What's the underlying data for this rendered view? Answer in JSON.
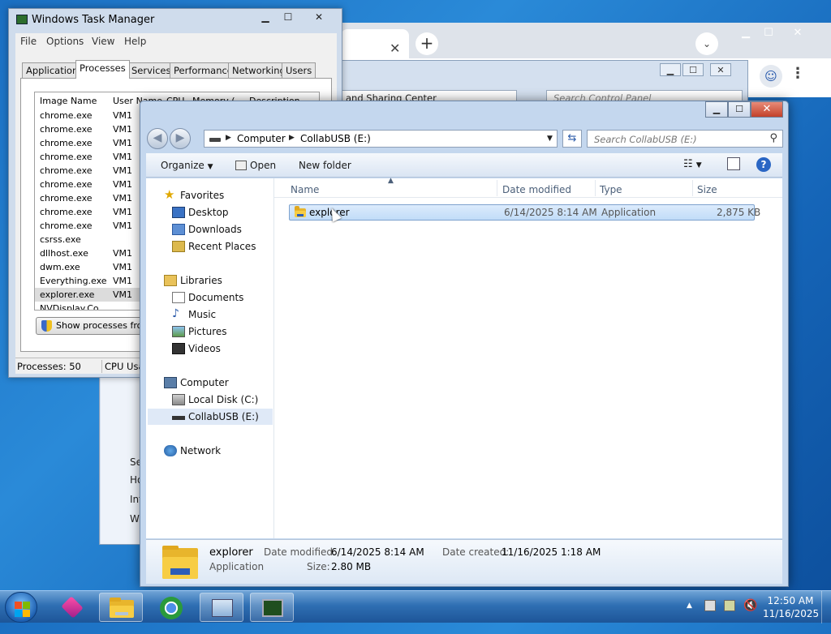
{
  "chrome": {
    "tab_close": "✕",
    "new_tab": "+",
    "menu_dropdown": "⌄",
    "profile_icon": "person-icon",
    "kebab": "⋮",
    "win_min": "▁",
    "win_max": "☐",
    "win_close": "✕"
  },
  "control_panel": {
    "address_text": "and Sharing Center",
    "search_placeholder": "Search Control Panel",
    "left_items": [
      "Se",
      "Ho",
      "Inf",
      "Wi"
    ]
  },
  "task_manager": {
    "title": "Windows Task Manager",
    "menu": [
      "File",
      "Options",
      "View",
      "Help"
    ],
    "tabs": [
      "Applications",
      "Processes",
      "Services",
      "Performance",
      "Networking",
      "Users"
    ],
    "active_tab": "Processes",
    "columns": [
      "Image Name",
      "User Name",
      "CPU",
      "Memory (...",
      "Description"
    ],
    "rows": [
      {
        "name": "chrome.exe",
        "user": "VM1"
      },
      {
        "name": "chrome.exe",
        "user": "VM1"
      },
      {
        "name": "chrome.exe",
        "user": "VM1"
      },
      {
        "name": "chrome.exe",
        "user": "VM1"
      },
      {
        "name": "chrome.exe",
        "user": "VM1"
      },
      {
        "name": "chrome.exe",
        "user": "VM1"
      },
      {
        "name": "chrome.exe",
        "user": "VM1"
      },
      {
        "name": "chrome.exe",
        "user": "VM1"
      },
      {
        "name": "chrome.exe",
        "user": "VM1"
      },
      {
        "name": "csrss.exe",
        "user": ""
      },
      {
        "name": "dllhost.exe",
        "user": "VM1"
      },
      {
        "name": "dwm.exe",
        "user": "VM1"
      },
      {
        "name": "Everything.exe",
        "user": "VM1"
      },
      {
        "name": "explorer.exe",
        "user": "VM1"
      },
      {
        "name": "NVDisplay.Co...",
        "user": ""
      }
    ],
    "selected_row": 13,
    "show_processes_button": "Show processes from",
    "status_processes": "Processes: 50",
    "status_cpu": "CPU Usa"
  },
  "explorer": {
    "breadcrumb": [
      "Computer",
      "CollabUSB (E:)"
    ],
    "search_placeholder": "Search CollabUSB (E:)",
    "toolbar": {
      "organize": "Organize",
      "open": "Open",
      "new_folder": "New folder"
    },
    "nav_tree": {
      "favorites": "Favorites",
      "desktop": "Desktop",
      "downloads": "Downloads",
      "recent_places": "Recent Places",
      "libraries": "Libraries",
      "documents": "Documents",
      "music": "Music",
      "pictures": "Pictures",
      "videos": "Videos",
      "computer": "Computer",
      "local_disk": "Local Disk (C:)",
      "collabusb": "CollabUSB (E:)",
      "network": "Network"
    },
    "columns": {
      "name": "Name",
      "date_modified": "Date modified",
      "type": "Type",
      "size": "Size"
    },
    "file": {
      "name": "explorer",
      "date_modified": "6/14/2025 8:14 AM",
      "type": "Application",
      "size": "2,875 KB"
    },
    "details": {
      "name": "explorer",
      "type": "Application",
      "date_modified_label": "Date modified:",
      "date_modified_value": "6/14/2025 8:14 AM",
      "size_label": "Size:",
      "size_value": "2.80 MB",
      "date_created_label": "Date created:",
      "date_created_value": "11/16/2025 1:18 AM"
    }
  },
  "taskbar": {
    "time": "12:50 AM",
    "date": "11/16/2025",
    "tray_arrow": "▲"
  },
  "colors": {
    "desktop": "#1b6fc2",
    "selection": "#c1dcf8",
    "folder": "#f7cd44"
  }
}
